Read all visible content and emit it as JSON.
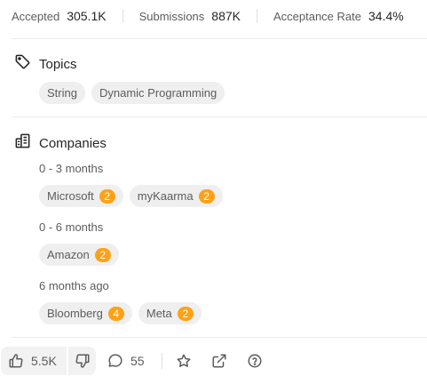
{
  "stats": {
    "accepted_label": "Accepted",
    "accepted_value": "305.1K",
    "submissions_label": "Submissions",
    "submissions_value": "887K",
    "acceptance_label": "Acceptance Rate",
    "acceptance_value": "34.4%"
  },
  "topics": {
    "title": "Topics",
    "tags": [
      "String",
      "Dynamic Programming"
    ]
  },
  "companies": {
    "title": "Companies",
    "groups": [
      {
        "period": "0 - 3 months",
        "items": [
          {
            "name": "Microsoft",
            "count": "2"
          },
          {
            "name": "myKaarma",
            "count": "2"
          }
        ]
      },
      {
        "period": "0 - 6 months",
        "items": [
          {
            "name": "Amazon",
            "count": "2"
          }
        ]
      },
      {
        "period": "6 months ago",
        "items": [
          {
            "name": "Bloomberg",
            "count": "4"
          },
          {
            "name": "Meta",
            "count": "2"
          }
        ]
      }
    ]
  },
  "actions": {
    "likes": "5.5K",
    "comments": "55",
    "icons": [
      "thumbs-up-icon",
      "thumbs-down-icon",
      "comment-icon",
      "star-icon",
      "share-icon",
      "help-icon"
    ]
  },
  "colors": {
    "accent_badge": "#ffa116",
    "tag_bg": "#efefef",
    "muted_text": "#5c5c5c",
    "primary_text": "#262626"
  }
}
